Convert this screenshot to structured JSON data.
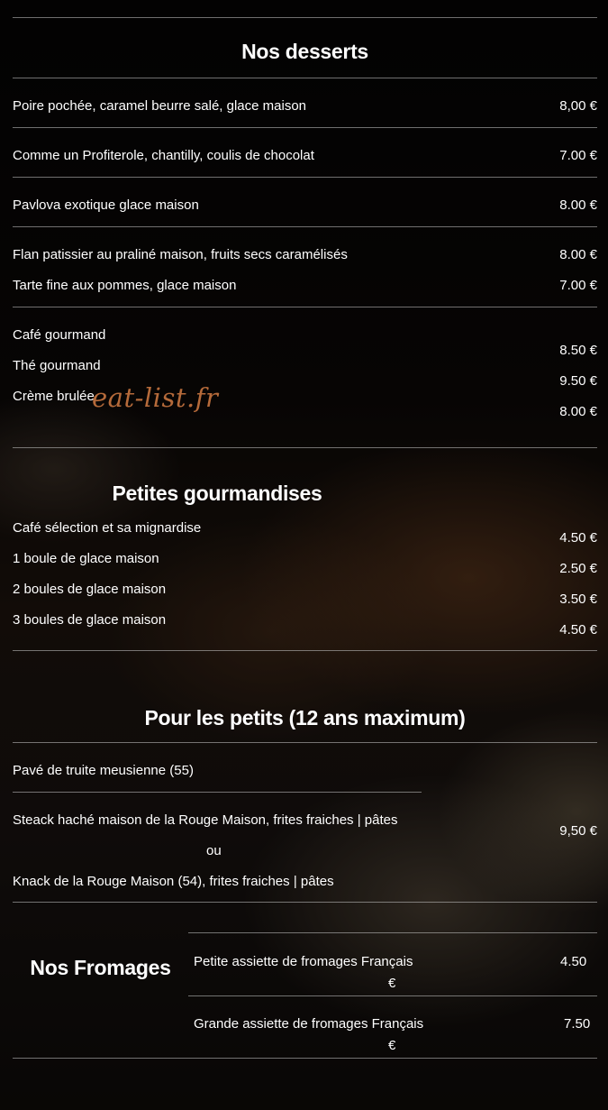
{
  "watermark": "eat-list.fr",
  "desserts": {
    "title": "Nos desserts",
    "items": [
      {
        "name": "Poire pochée, caramel beurre salé, glace maison",
        "price": "8,00 €"
      },
      {
        "name": "Comme un Profiterole, chantilly, coulis de chocolat",
        "price": "7.00 €"
      },
      {
        "name": "Pavlova exotique glace maison",
        "price": "8.00 €"
      },
      {
        "name": "Flan patissier au praliné maison, fruits secs caramélisés",
        "price": "8.00 €"
      },
      {
        "name": "Tarte fine aux pommes, glace maison",
        "price": "7.00 €"
      },
      {
        "name": "Café gourmand",
        "price": "8.50 €"
      },
      {
        "name": "Thé gourmand",
        "price": "9.50 €"
      },
      {
        "name": "Crème brulée",
        "price": "8.00 €"
      }
    ]
  },
  "gourmandises": {
    "title": "Petites gourmandises",
    "items": [
      {
        "name": "Café sélection et sa mignardise",
        "price": "4.50 €"
      },
      {
        "name": "1 boule de glace maison",
        "price": "2.50 €"
      },
      {
        "name": "2 boules de glace maison",
        "price": "3.50 €"
      },
      {
        "name": "3 boules de glace maison",
        "price": "4.50 €"
      }
    ]
  },
  "petits": {
    "title": "Pour les petits (12 ans maximum)",
    "item1": "Pavé de truite meusienne (55)",
    "item2": "Steack haché maison de la Rouge Maison, frites fraiches | pâtes",
    "or": "ou",
    "item3": "Knack de la Rouge Maison (54), frites fraiches | pâtes",
    "price": "9,50 €"
  },
  "fromages": {
    "title": "Nos Fromages",
    "items": [
      {
        "name": "Petite assiette de fromages Français",
        "price": "4.50",
        "currency": "€"
      },
      {
        "name": "Grande assiette de fromages Français",
        "price": "7.50",
        "currency": "€"
      }
    ]
  }
}
